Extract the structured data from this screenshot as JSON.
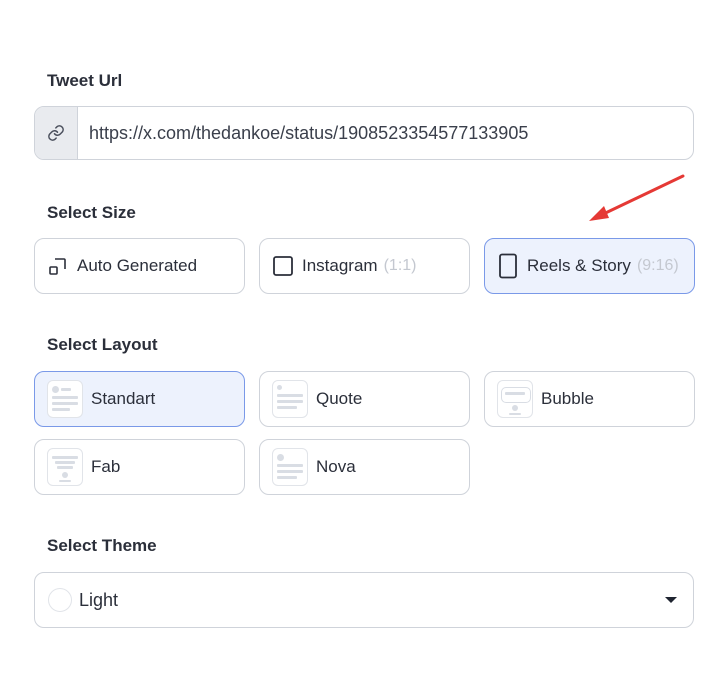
{
  "tweet_url": {
    "label": "Tweet Url",
    "value": "https://x.com/thedankoe/status/1908523354577133905",
    "icon": "link-icon"
  },
  "select_size": {
    "label": "Select Size",
    "options": [
      {
        "label": "Auto Generated",
        "ratio": "",
        "icon": "auto-size-icon",
        "selected": false
      },
      {
        "label": "Instagram",
        "ratio": "(1:1)",
        "icon": "square-icon",
        "selected": false
      },
      {
        "label": "Reels & Story",
        "ratio": "(9:16)",
        "icon": "portrait-icon",
        "selected": true
      }
    ]
  },
  "select_layout": {
    "label": "Select Layout",
    "options": [
      {
        "label": "Standart",
        "selected": true
      },
      {
        "label": "Quote",
        "selected": false
      },
      {
        "label": "Bubble",
        "selected": false
      },
      {
        "label": "Fab",
        "selected": false
      },
      {
        "label": "Nova",
        "selected": false
      }
    ]
  },
  "select_theme": {
    "label": "Select Theme",
    "value": "Light"
  },
  "annotation": {
    "color": "#e53935"
  }
}
